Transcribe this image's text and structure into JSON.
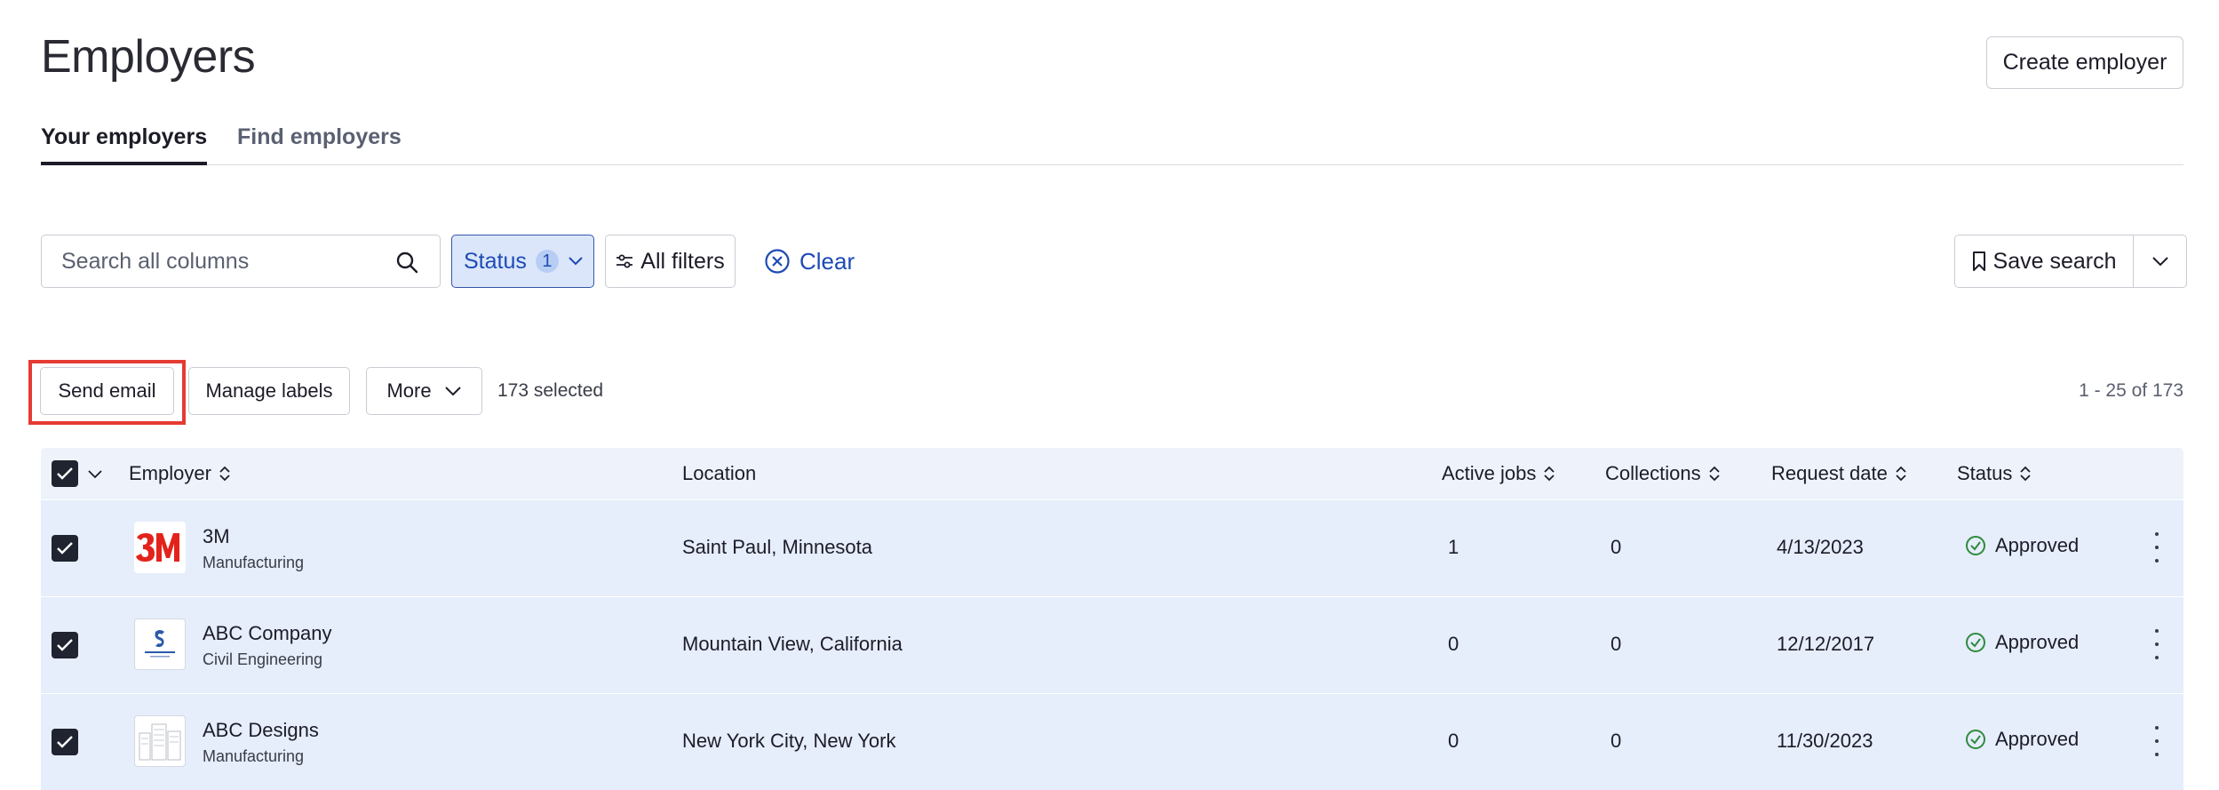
{
  "page": {
    "title": "Employers",
    "create_button": "Create employer"
  },
  "tabs": [
    {
      "label": "Your employers",
      "active": true
    },
    {
      "label": "Find employers",
      "active": false
    }
  ],
  "filters": {
    "search_placeholder": "Search all columns",
    "status_label": "Status",
    "status_count": "1",
    "all_filters_label": "All filters",
    "clear_label": "Clear",
    "save_search_label": "Save search"
  },
  "bulk_actions": {
    "send_email": "Send email",
    "manage_labels": "Manage labels",
    "more": "More",
    "selected_text": "173 selected",
    "range_text": "1 - 25 of 173"
  },
  "table": {
    "columns": [
      "Employer",
      "Location",
      "Active jobs",
      "Collections",
      "Request date",
      "Status"
    ],
    "rows": [
      {
        "name": "3M",
        "industry": "Manufacturing",
        "location": "Saint Paul, Minnesota",
        "active_jobs": "1",
        "collections": "0",
        "request_date": "4/13/2023",
        "status": "Approved",
        "selected": true,
        "logo": "3m-logo"
      },
      {
        "name": "ABC Company",
        "industry": "Civil Engineering",
        "location": "Mountain View, California",
        "active_jobs": "0",
        "collections": "0",
        "request_date": "12/12/2017",
        "status": "Approved",
        "selected": true,
        "logo": "company-name-logo"
      },
      {
        "name": "ABC Designs",
        "industry": "Manufacturing",
        "location": "New York City, New York",
        "active_jobs": "0",
        "collections": "0",
        "request_date": "11/30/2023",
        "status": "Approved",
        "selected": true,
        "logo": "building-sketch-logo"
      }
    ]
  },
  "colors": {
    "accent": "#1d4ab5",
    "row_selected_bg": "#e6edfb",
    "header_bg": "#eef3fb",
    "approved_green": "#2e8b3d",
    "highlight_red": "#e53b32"
  }
}
